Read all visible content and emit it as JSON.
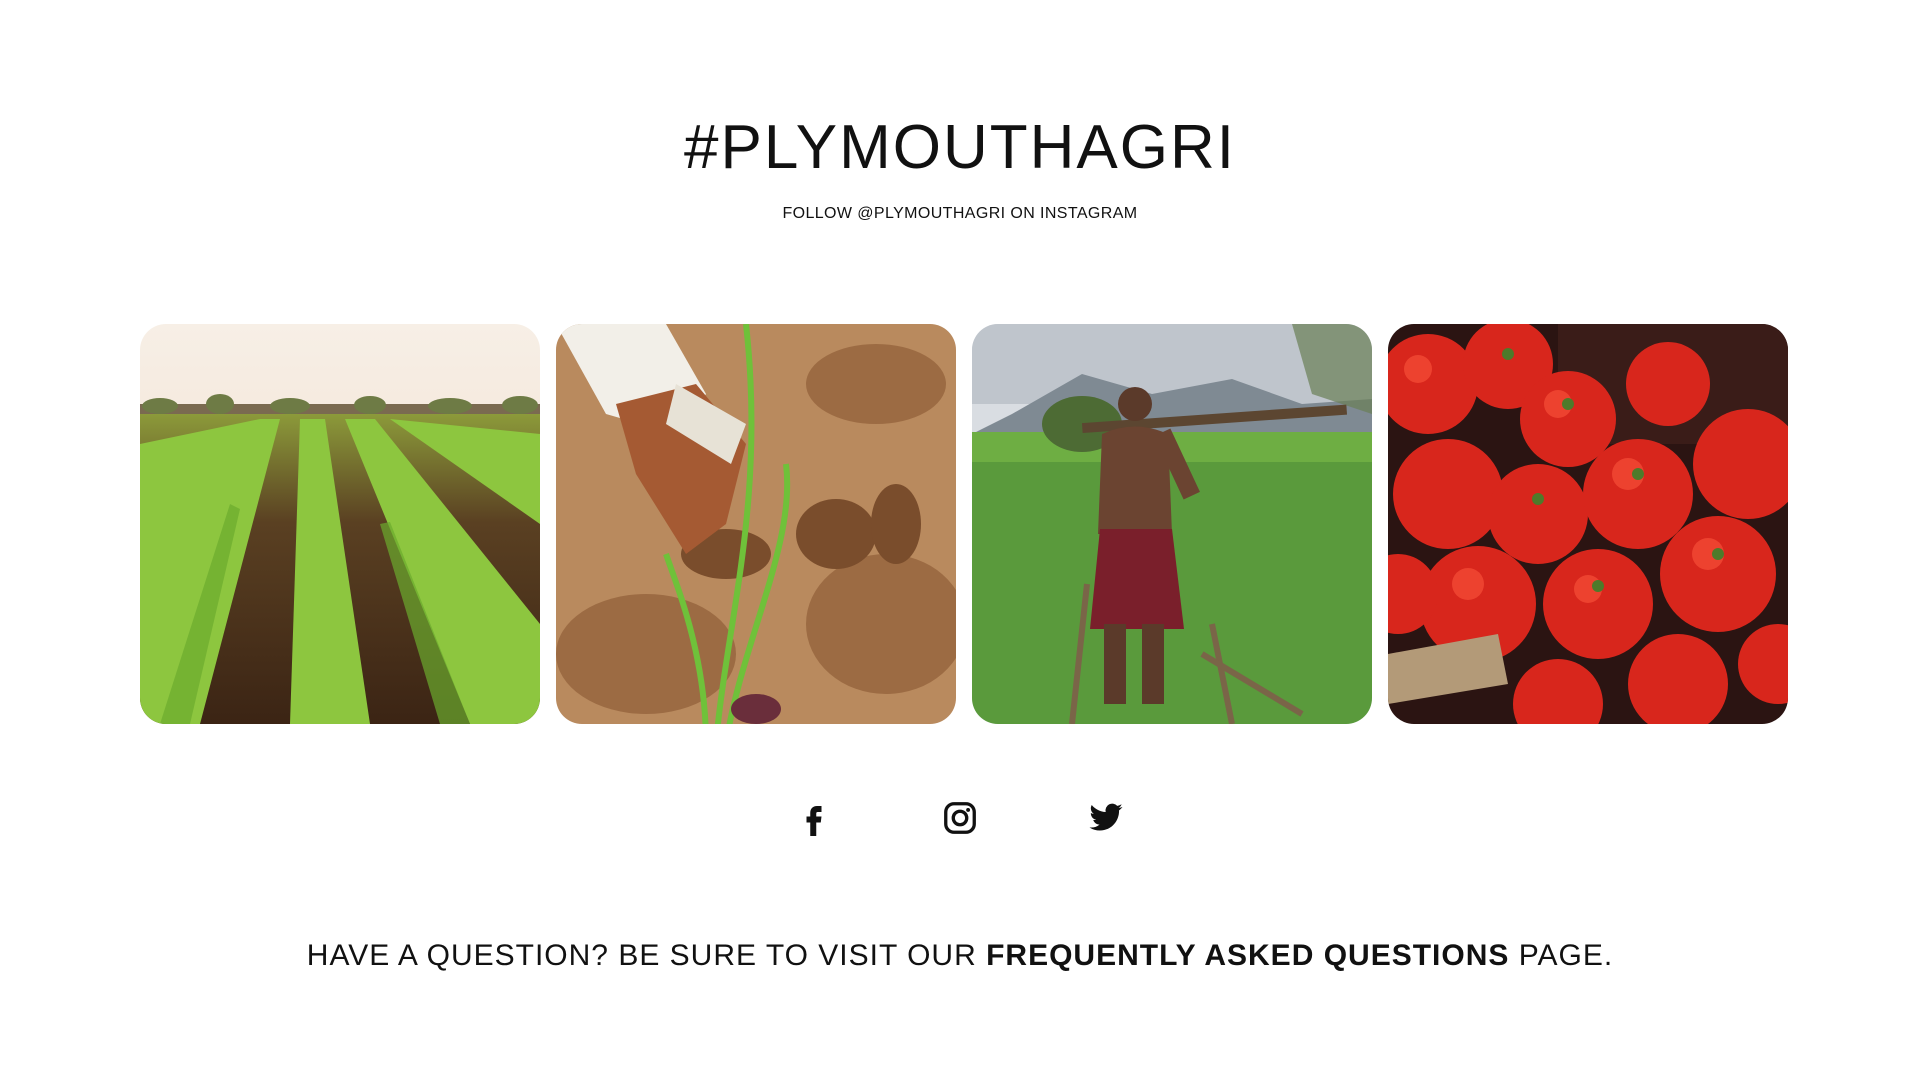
{
  "section": {
    "title": "#PLYMOUTHAGRI",
    "follow_text": "FOLLOW @PLYMOUTHAGRI ON INSTAGRAM"
  },
  "gallery": {
    "images": [
      {
        "subject": "young crop rows in a field"
      },
      {
        "subject": "gloved hand planting onion seedling"
      },
      {
        "subject": "farmer with hoe in green field"
      },
      {
        "subject": "basket of red tomatoes"
      }
    ]
  },
  "social": {
    "icons": [
      "facebook-icon",
      "instagram-icon",
      "twitter-icon"
    ]
  },
  "faq": {
    "prefix": "HAVE A QUESTION? BE SURE TO VISIT OUR ",
    "link_text": "FREQUENTLY ASKED QUESTIONS",
    "suffix": " PAGE."
  }
}
